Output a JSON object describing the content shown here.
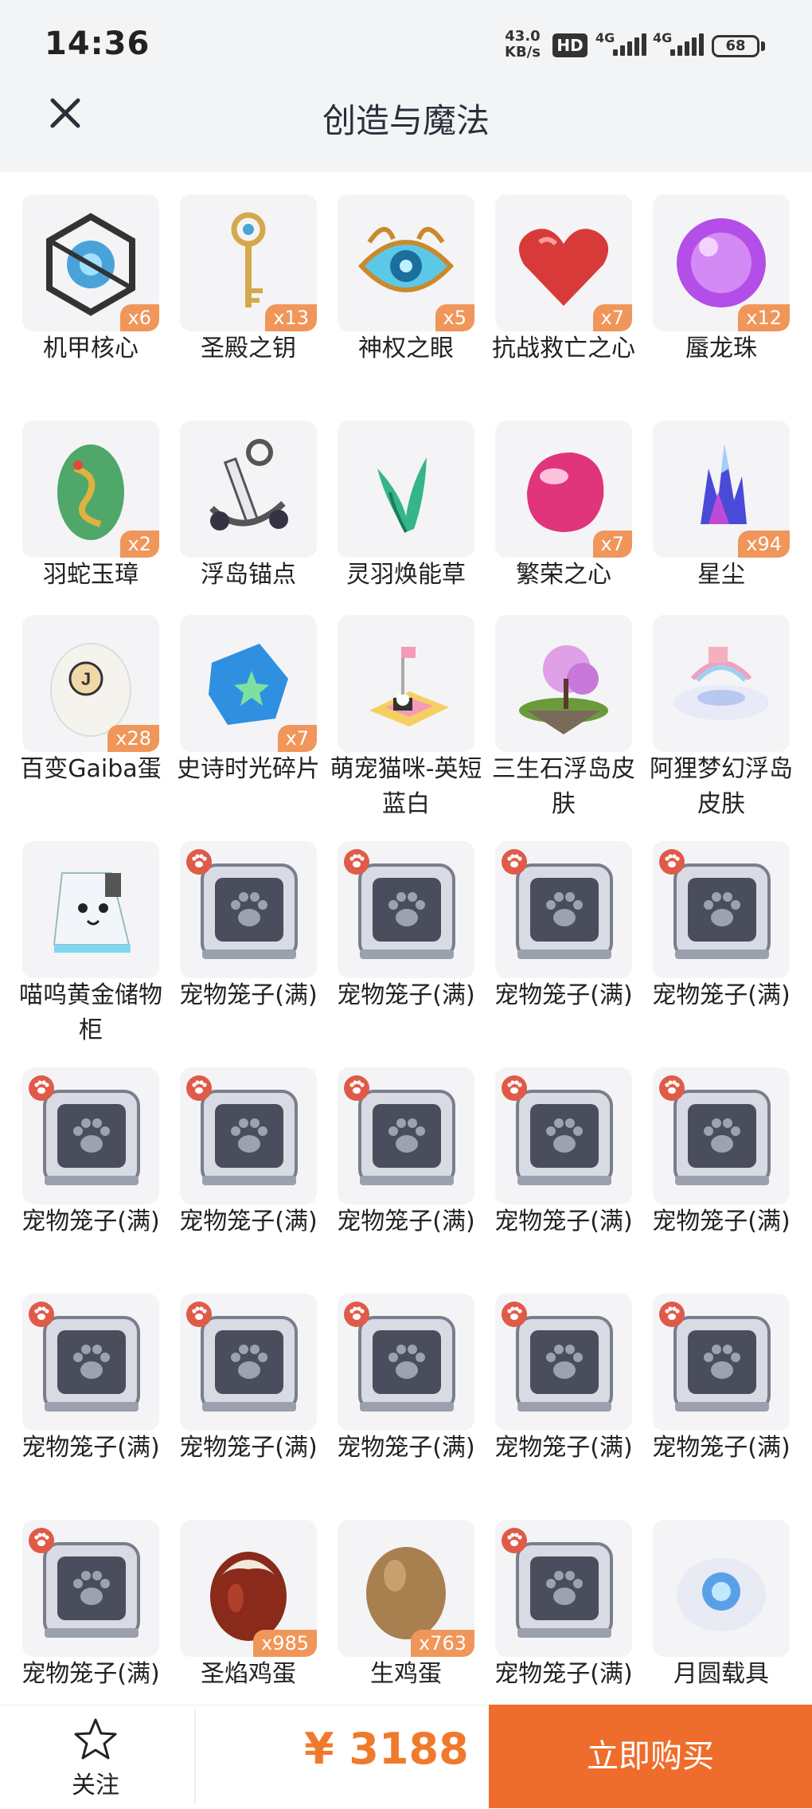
{
  "status_bar": {
    "time": "14:36",
    "net_speed_value": "43.0",
    "net_speed_unit": "KB/s",
    "hd_label": "HD",
    "signal1_label": "4G",
    "signal2_label": "4G",
    "battery": "68"
  },
  "header": {
    "title": "创造与魔法",
    "close_icon": "close-icon"
  },
  "items": [
    {
      "name": "机甲核心",
      "count": "x6",
      "icon": "mech-core"
    },
    {
      "name": "圣殿之钥",
      "count": "x13",
      "icon": "key"
    },
    {
      "name": "神权之眼",
      "count": "x5",
      "icon": "eye"
    },
    {
      "name": "抗战救亡之心",
      "count": "x7",
      "icon": "heart"
    },
    {
      "name": "蜃龙珠",
      "count": "x12",
      "icon": "orb"
    },
    {
      "name": "羽蛇玉璋",
      "count": "x2",
      "icon": "jade"
    },
    {
      "name": "浮岛锚点",
      "count": "",
      "icon": "anchor"
    },
    {
      "name": "灵羽焕能草",
      "count": "",
      "icon": "grass"
    },
    {
      "name": "繁荣之心",
      "count": "x7",
      "icon": "pink-gem"
    },
    {
      "name": "星尘",
      "count": "x94",
      "icon": "crystal"
    },
    {
      "name": "百变Gaiba蛋",
      "count": "x28",
      "icon": "white-egg"
    },
    {
      "name": "史诗时光碎片",
      "count": "x7",
      "icon": "puzzle"
    },
    {
      "name": "萌宠猫咪-英短蓝白",
      "count": "",
      "icon": "cat-bed"
    },
    {
      "name": "三生石浮岛皮肤",
      "count": "",
      "icon": "island"
    },
    {
      "name": "阿狸梦幻浮岛皮肤",
      "count": "",
      "icon": "cloud-island"
    },
    {
      "name": "喵呜黄金储物柜",
      "count": "",
      "icon": "cabinet"
    },
    {
      "name": "宠物笼子(满)",
      "count": "",
      "icon": "cage"
    },
    {
      "name": "宠物笼子(满)",
      "count": "",
      "icon": "cage"
    },
    {
      "name": "宠物笼子(满)",
      "count": "",
      "icon": "cage"
    },
    {
      "name": "宠物笼子(满)",
      "count": "",
      "icon": "cage"
    },
    {
      "name": "宠物笼子(满)",
      "count": "",
      "icon": "cage"
    },
    {
      "name": "宠物笼子(满)",
      "count": "",
      "icon": "cage"
    },
    {
      "name": "宠物笼子(满)",
      "count": "",
      "icon": "cage"
    },
    {
      "name": "宠物笼子(满)",
      "count": "",
      "icon": "cage"
    },
    {
      "name": "宠物笼子(满)",
      "count": "",
      "icon": "cage"
    },
    {
      "name": "宠物笼子(满)",
      "count": "",
      "icon": "cage"
    },
    {
      "name": "宠物笼子(满)",
      "count": "",
      "icon": "cage"
    },
    {
      "name": "宠物笼子(满)",
      "count": "",
      "icon": "cage"
    },
    {
      "name": "宠物笼子(满)",
      "count": "",
      "icon": "cage"
    },
    {
      "name": "宠物笼子(满)",
      "count": "",
      "icon": "cage"
    },
    {
      "name": "宠物笼子(满)",
      "count": "",
      "icon": "cage"
    },
    {
      "name": "圣焰鸡蛋",
      "count": "x985",
      "icon": "brown-egg"
    },
    {
      "name": "生鸡蛋",
      "count": "x763",
      "icon": "raw-egg"
    },
    {
      "name": "宠物笼子(满)",
      "count": "",
      "icon": "cage"
    },
    {
      "name": "月圆载具",
      "count": "",
      "icon": "moon-vehicle"
    }
  ],
  "bottom_bar": {
    "follow_label": "关注",
    "follow_icon": "star-icon",
    "price": "¥ 3188",
    "buy_label": "立即购买"
  },
  "colors": {
    "accent": "#ef6d2c",
    "price": "#f07a2c",
    "badge": "#f0965a",
    "tile_bg": "#f4f4f6"
  }
}
